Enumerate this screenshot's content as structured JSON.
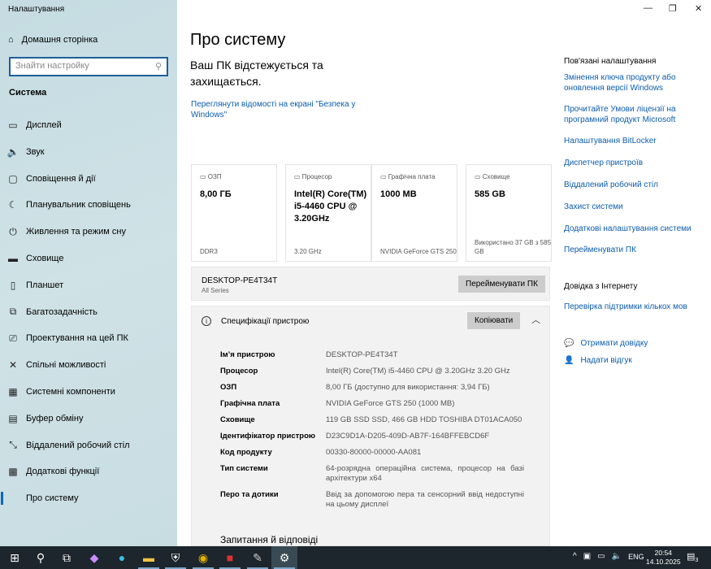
{
  "app_title": "Налаштування",
  "sidebar": {
    "home": "Домашня сторінка",
    "search_placeholder": "Знайти настройку",
    "section": "Система",
    "items": [
      {
        "label": "Дисплей",
        "icon": "display-icon"
      },
      {
        "label": "Звук",
        "icon": "sound-icon"
      },
      {
        "label": "Сповіщення й дії",
        "icon": "notifications-icon"
      },
      {
        "label": "Планувальник сповіщень",
        "icon": "focus-icon"
      },
      {
        "label": "Живлення та режим сну",
        "icon": "power-icon"
      },
      {
        "label": "Сховище",
        "icon": "storage-icon"
      },
      {
        "label": "Планшет",
        "icon": "tablet-icon"
      },
      {
        "label": "Багатозадачність",
        "icon": "multitasking-icon"
      },
      {
        "label": "Проектування на цей ПК",
        "icon": "projecting-icon"
      },
      {
        "label": "Спільні можливості",
        "icon": "shared-icon"
      },
      {
        "label": "Системні компоненти",
        "icon": "components-icon"
      },
      {
        "label": "Буфер обміну",
        "icon": "clipboard-icon"
      },
      {
        "label": "Віддалений робочий стіл",
        "icon": "remote-desktop-icon"
      },
      {
        "label": "Додаткові функції",
        "icon": "optional-features-icon"
      },
      {
        "label": "Про систему",
        "icon": "info-icon"
      }
    ]
  },
  "main": {
    "title": "Про систему",
    "protect": "Ваш ПК відстежується та захищається.",
    "security_link": "Переглянути відомості на екрані \"Безпека у Windows\"",
    "cards": [
      {
        "label": "ОЗП",
        "value": "8,00 ГБ",
        "sub": "DDR3"
      },
      {
        "label": "Процесор",
        "value": "Intel(R) Core(TM) i5-4460  CPU @ 3.20GHz",
        "sub": "3.20 GHz"
      },
      {
        "label": "Графічна плата",
        "value": "1000 MB",
        "sub": "NVIDIA GeForce GTS 250"
      },
      {
        "label": "Сховище",
        "value": "585 GB",
        "sub": "Використано 37 GB з 585 GB"
      }
    ],
    "pc_name": "DESKTOP-PE4T34T",
    "pc_model": "All Series",
    "rename": "Перейменувати ПК",
    "specs_title": "Специфікації пристрою",
    "copy": "Копіювати",
    "specs": [
      {
        "k": "Ім’я пристрою",
        "v": "DESKTOP-PE4T34T"
      },
      {
        "k": "Процесор",
        "v": "Intel(R) Core(TM) i5-4460  CPU @ 3.20GHz   3.20 GHz"
      },
      {
        "k": "ОЗП",
        "v": "8,00 ГБ (доступно для використання: 3,94 ГБ)"
      },
      {
        "k": "Графічна плата",
        "v": "NVIDIA GeForce GTS 250 (1000 MB)"
      },
      {
        "k": "Сховище",
        "v": "119 GB SSD SSD, 466 GB HDD TOSHIBA DT01ACA050"
      },
      {
        "k": "Ідентифікатор пристрою",
        "v": "D23C9D1A-D205-409D-AB7F-164BFFEBCD6F"
      },
      {
        "k": "Код продукту",
        "v": "00330-80000-00000-AA081"
      },
      {
        "k": "Тип системи",
        "v": "64-розрядна операційна система, процесор на базі архітектури x64"
      },
      {
        "k": "Перо та дотики",
        "v": "Ввід за допомогою пера та сенсорний ввід недоступні на цьому дисплеї"
      }
    ],
    "faq": "Запитання й відповіді"
  },
  "related": {
    "title": "Пов'язані налаштування",
    "links": [
      "Змінення ключа продукту або оновлення версії Windows",
      "Прочитайте Умови ліцензії на програмний продукт Microsoft",
      "Налаштування BitLocker",
      "Диспетчер пристроїв",
      "Віддалений робочий стіл",
      "Захист системи",
      "Додаткові налаштування системи",
      "Перейменувати ПК"
    ],
    "help_title": "Довідка з Інтернету",
    "help_link": "Перевірка підтримки кількох мов",
    "get_help": "Отримати довідку",
    "feedback": "Надати відгук"
  },
  "taskbar": {
    "lang": "ENG",
    "time": "20:54",
    "date": "14.10.2025",
    "notif_count": "3"
  }
}
